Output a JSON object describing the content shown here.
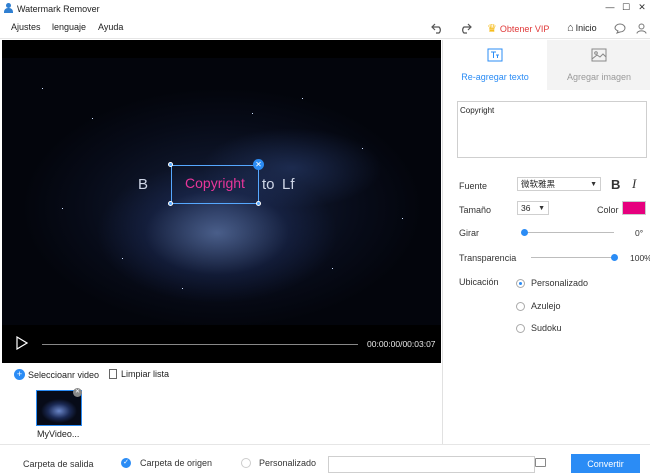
{
  "window": {
    "title": "Watermark Remover",
    "buttons": [
      "—",
      "☐",
      "✕"
    ]
  },
  "menu": {
    "items": [
      "Ajustes",
      "lenguaje",
      "Ayuda"
    ]
  },
  "toolbar": {
    "vip_label": "Obtener VIP",
    "home_label": "Inicio"
  },
  "video": {
    "overlay_text_left": "B",
    "overlay_text_right_1": "to",
    "overlay_text_right_2": "Lf",
    "watermark_text": "Copyright",
    "time": "00:00:00/00:03:07",
    "progress": 0
  },
  "file_list": {
    "select_label": "Seleccioanr video",
    "clear_label": "Limpiar lista",
    "items": [
      {
        "name": "MyVideo..."
      }
    ]
  },
  "panel": {
    "tab_text": "Re-agregar texto",
    "tab_image": "Agregar imagen",
    "text_value": "Copyright",
    "font_label": "Fuente",
    "font_value": "微软雅黑",
    "bold": "B",
    "italic": "I",
    "size_label": "Tamaño",
    "size_value": "36",
    "color_label": "Color",
    "color_value": "#e6007e",
    "rotate_label": "Girar",
    "rotate_value": "0°",
    "rotate_fraction": 0.0,
    "transparency_label": "Transparencia",
    "transparency_value": "100%",
    "transparency_fraction": 1.0,
    "location_label": "Ubicación",
    "location_options": [
      "Personalizado",
      "Azulejo",
      "Sudoku"
    ],
    "location_selected": "Personalizado"
  },
  "output": {
    "folder_label": "Carpeta de salida",
    "origin_label": "Carpeta de origen",
    "custom_label": "Personalizado",
    "path_value": "",
    "convert_label": "Convertir"
  },
  "colors": {
    "accent": "#2b8cf5",
    "vip": "#e03a3a",
    "watermark": "#e8369a"
  }
}
